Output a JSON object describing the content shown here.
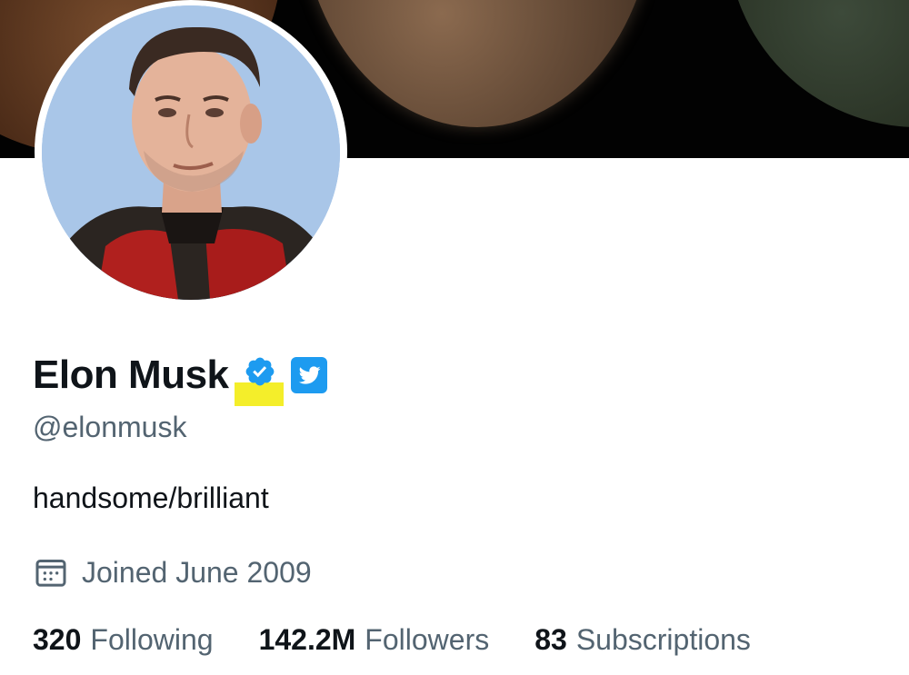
{
  "profile": {
    "display_name": "Elon Musk",
    "handle": "@elonmusk",
    "bio": "handsome/brilliant",
    "joined": "Joined June 2009",
    "verified_icon": "verified-badge-icon",
    "affiliate_icon": "twitter-bird-icon"
  },
  "stats": {
    "following": {
      "count": "320",
      "label": "Following"
    },
    "followers": {
      "count": "142.2M",
      "label": "Followers"
    },
    "subscriptions": {
      "count": "83",
      "label": "Subscriptions"
    }
  },
  "colors": {
    "verified": "#1d9bf0",
    "highlight": "#f4ee2a",
    "secondary_text": "#536471",
    "primary_text": "#0f1419"
  }
}
